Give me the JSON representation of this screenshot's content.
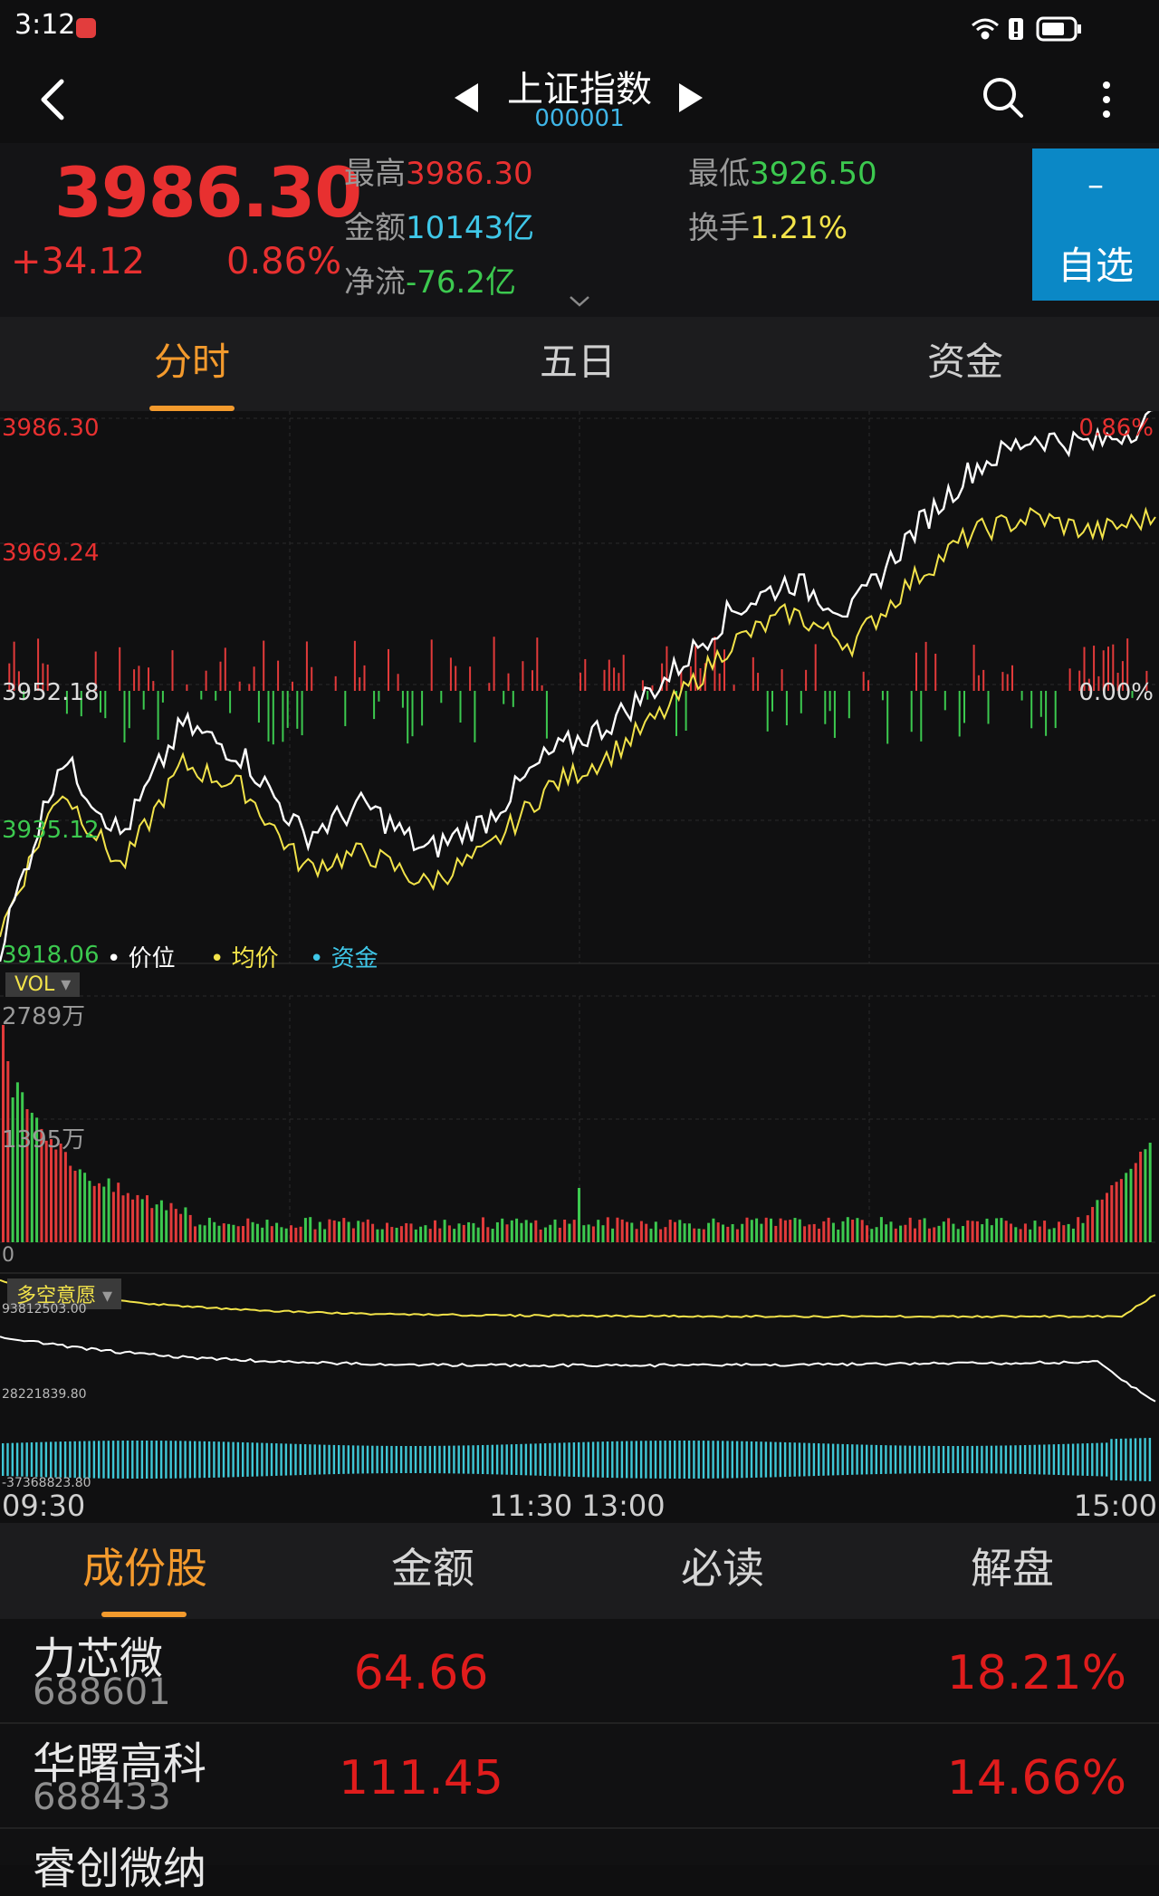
{
  "status_bar": {
    "time": "3:12"
  },
  "header": {
    "title": "上证指数",
    "code": "000001"
  },
  "quote": {
    "price": "3986.30",
    "change": "+34.12",
    "change_pct": "0.86%",
    "high_label": "最高",
    "high_value": "3986.30",
    "low_label": "最低",
    "low_value": "3926.50",
    "amount_label": "金额",
    "amount_value": "10143亿",
    "turnover_label": "换手",
    "turnover_value": "1.21%",
    "netflow_label": "净流",
    "netflow_value": "-76.2亿",
    "fav_symbol": "–",
    "fav_label": "自选"
  },
  "tabs": [
    {
      "label": "分时",
      "active": true
    },
    {
      "label": "五日",
      "active": false
    },
    {
      "label": "资金",
      "active": false
    }
  ],
  "chart": {
    "price_axis": [
      "3986.30",
      "3969.24",
      "3952.18",
      "3935.12",
      "3918.06"
    ],
    "pct_top": "0.86%",
    "pct_mid": "0.00%",
    "legend": [
      "价位",
      "均价",
      "资金"
    ],
    "vol_tag": "VOL",
    "vol_axis": [
      "2789万",
      "1395万",
      "0"
    ],
    "ind_tag": "多空意愿",
    "ind_axis": [
      "93812503.00",
      "28221839.80",
      "-37368823.80"
    ],
    "time_axis": {
      "start": "09:30",
      "mid": "11:30 13:00",
      "end": "15:00"
    },
    "colors": {
      "price": "#ffffff",
      "avg": "#f2e34a",
      "up": "#e23a3a",
      "down": "#3cc94f",
      "flow": "#3fc7d6"
    }
  },
  "chart_data": {
    "type": "line",
    "series": [
      {
        "name": "价位",
        "x_range": [
          "09:30",
          "15:00"
        ],
        "approx_values": [
          3920,
          3944,
          3934,
          3948,
          3944,
          3934,
          3938,
          3932,
          3936,
          3944,
          3948,
          3954,
          3962,
          3966,
          3962,
          3972,
          3980,
          3984,
          3983,
          3986.3
        ]
      },
      {
        "name": "均价",
        "x_range": [
          "09:30",
          "15:00"
        ],
        "approx_values": [
          3922,
          3940,
          3930,
          3943,
          3940,
          3930,
          3932,
          3928,
          3932,
          3940,
          3944,
          3950,
          3958,
          3962,
          3958,
          3966,
          3972,
          3974,
          3972,
          3974
        ]
      }
    ],
    "ylim": [
      3918.06,
      3986.3
    ],
    "xlabel": "",
    "ylabel": ""
  },
  "bottom_tabs": [
    {
      "label": "成份股",
      "active": true
    },
    {
      "label": "金额",
      "active": false
    },
    {
      "label": "必读",
      "active": false
    },
    {
      "label": "解盘",
      "active": false
    }
  ],
  "stocks": [
    {
      "name": "力芯微",
      "code": "688601",
      "price": "64.66",
      "pct": "18.21%"
    },
    {
      "name": "华曙高科",
      "code": "688433",
      "price": "111.45",
      "pct": "14.66%"
    },
    {
      "name": "睿创微纳",
      "code": "",
      "price": "",
      "pct": ""
    }
  ]
}
